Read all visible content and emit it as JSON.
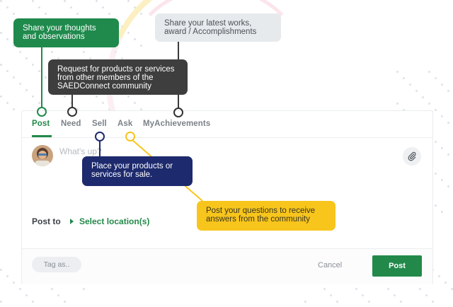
{
  "composer": {
    "tabs": [
      {
        "label": "Post"
      },
      {
        "label": "Need"
      },
      {
        "label": "Sell"
      },
      {
        "label": "Ask"
      },
      {
        "label": "MyAchievements"
      }
    ],
    "placeholder": "What's up?",
    "post_to_label": "Post to",
    "location_label": "Select location(s)",
    "tag_label": "Tag as..",
    "cancel_label": "Cancel",
    "post_button_label": "Post",
    "attach_icon": "paperclip-icon",
    "accent_color": "#22894a"
  },
  "tooltips": {
    "post": "Share your thoughts\nand observations",
    "achievements": "Share your latest works,\naward / Accomplishments",
    "need": "Request for products or services\nfrom other members of the\nSAEDConnect community",
    "sell": "Place your products or\nservices for sale.",
    "ask": "Post your questions to receive\nanswers from the community"
  }
}
